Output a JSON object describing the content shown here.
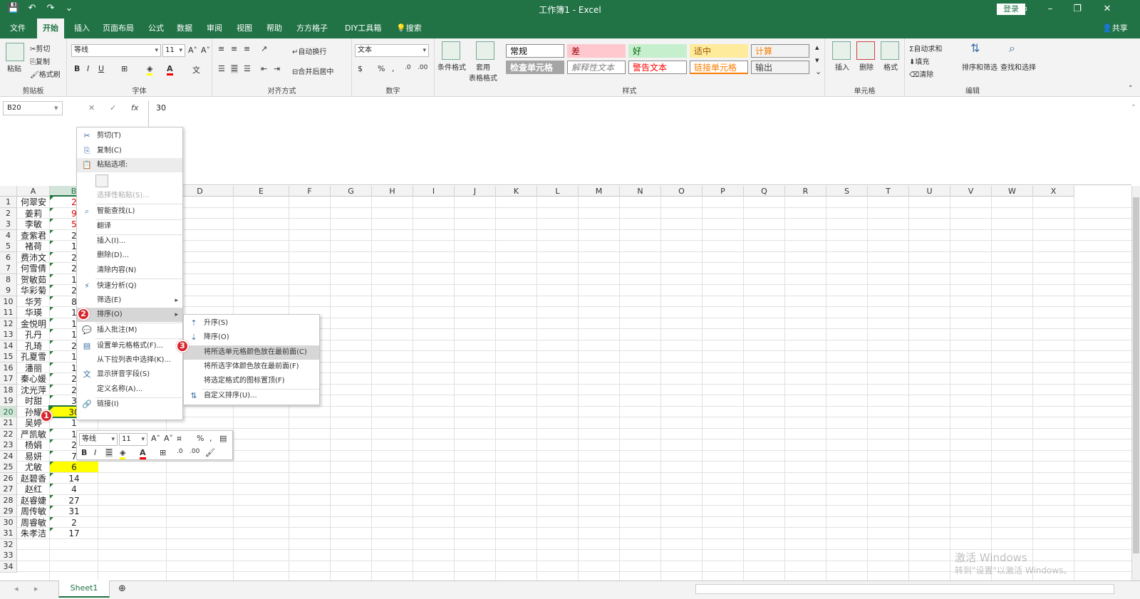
{
  "window": {
    "title": "工作簿1  -  Excel",
    "login": "登录"
  },
  "tabs": [
    "文件",
    "开始",
    "插入",
    "页面布局",
    "公式",
    "数据",
    "审阅",
    "视图",
    "帮助",
    "方方格子",
    "DIY工具箱"
  ],
  "search_label": "搜索",
  "share_label": "共享",
  "ribbon": {
    "clipboard": {
      "label": "剪贴板",
      "paste": "粘贴",
      "cut": "剪切",
      "copy": "复制",
      "format_painter": "格式刷"
    },
    "font": {
      "label": "字体",
      "name": "等线",
      "size": "11"
    },
    "align": {
      "label": "对齐方式",
      "wrap": "自动换行",
      "merge": "合并后居中"
    },
    "number": {
      "label": "数字",
      "format": "文本"
    },
    "styles_group": {
      "label": "样式",
      "cond": "条件格式",
      "table": "套用\n表格格式"
    },
    "styles": [
      {
        "text": "常规",
        "bg": "#ffffff",
        "fg": "#000000"
      },
      {
        "text": "差",
        "bg": "#ffc7ce",
        "fg": "#9c0006"
      },
      {
        "text": "好",
        "bg": "#c6efce",
        "fg": "#006100"
      },
      {
        "text": "适中",
        "bg": "#ffeb9c",
        "fg": "#9c5700"
      },
      {
        "text": "计算",
        "bg": "#f2f2f2",
        "fg": "#fa7d00"
      },
      {
        "text": "检查单元格",
        "bg": "#a5a5a5",
        "fg": "#ffffff"
      },
      {
        "text": "解释性文本",
        "bg": "#ffffff",
        "fg": "#7f7f7f"
      },
      {
        "text": "警告文本",
        "bg": "#ffffff",
        "fg": "#ff0000"
      },
      {
        "text": "链接单元格",
        "bg": "#ffffff",
        "fg": "#fa7d00"
      },
      {
        "text": "输出",
        "bg": "#f2f2f2",
        "fg": "#3f3f3f"
      }
    ],
    "cells": {
      "label": "单元格",
      "insert": "插入",
      "delete": "删除",
      "format": "格式"
    },
    "editing": {
      "label": "编辑",
      "autosum": "自动求和",
      "fill": "填充",
      "clear": "清除",
      "sort": "排序和筛选",
      "find": "查找和选择"
    }
  },
  "formula_bar": {
    "name_box": "B20",
    "value": "30",
    "fx": "fx"
  },
  "columns": [
    "A",
    "B",
    "C",
    "D",
    "E",
    "F",
    "G",
    "H",
    "I",
    "J",
    "K",
    "L",
    "M",
    "N",
    "O",
    "P",
    "Q",
    "R",
    "S",
    "T",
    "U",
    "V",
    "W",
    "X"
  ],
  "rows": [
    {
      "n": "1",
      "name": "何翠安",
      "val": "2"
    },
    {
      "n": "2",
      "name": "姜莉",
      "val": "9"
    },
    {
      "n": "3",
      "name": "李敏",
      "val": "5"
    },
    {
      "n": "4",
      "name": "查紫君",
      "val": "2"
    },
    {
      "n": "5",
      "name": "褚荷",
      "val": "1"
    },
    {
      "n": "6",
      "name": "费沛文",
      "val": "2"
    },
    {
      "n": "7",
      "name": "何雪倩",
      "val": "2"
    },
    {
      "n": "8",
      "name": "贺敏茹",
      "val": "1"
    },
    {
      "n": "9",
      "name": "华彩菊",
      "val": "2"
    },
    {
      "n": "10",
      "name": "华芳",
      "val": "8"
    },
    {
      "n": "11",
      "name": "华瑛",
      "val": "1"
    },
    {
      "n": "12",
      "name": "金悦明",
      "val": "1"
    },
    {
      "n": "13",
      "name": "孔丹",
      "val": "1"
    },
    {
      "n": "14",
      "name": "孔琦",
      "val": "2"
    },
    {
      "n": "15",
      "name": "孔夏雪",
      "val": "1"
    },
    {
      "n": "16",
      "name": "潘丽",
      "val": "1"
    },
    {
      "n": "17",
      "name": "秦心媛",
      "val": "2"
    },
    {
      "n": "18",
      "name": "沈光萍",
      "val": "2"
    },
    {
      "n": "19",
      "name": "时甜",
      "val": "3"
    },
    {
      "n": "20",
      "name": "孙耀",
      "val": "30"
    },
    {
      "n": "21",
      "name": "吴婷",
      "val": "1"
    },
    {
      "n": "22",
      "name": "严凯敏",
      "val": "1"
    },
    {
      "n": "23",
      "name": "杨娟",
      "val": "2"
    },
    {
      "n": "24",
      "name": "易妍",
      "val": "7"
    },
    {
      "n": "25",
      "name": "尤敏",
      "val": "6"
    },
    {
      "n": "26",
      "name": "赵碧香",
      "val": "14"
    },
    {
      "n": "27",
      "name": "赵红",
      "val": "4"
    },
    {
      "n": "28",
      "name": "赵睿婕",
      "val": "27"
    },
    {
      "n": "29",
      "name": "周传敏",
      "val": "31"
    },
    {
      "n": "30",
      "name": "周睿敏",
      "val": "2"
    },
    {
      "n": "31",
      "name": "朱孝洁",
      "val": "17"
    },
    {
      "n": "32",
      "name": "",
      "val": ""
    },
    {
      "n": "33",
      "name": "",
      "val": ""
    },
    {
      "n": "34",
      "name": "",
      "val": ""
    }
  ],
  "context_menu": {
    "cut": "剪切(T)",
    "copy": "复制(C)",
    "paste_options": "粘贴选项:",
    "paste_special": "选择性粘贴(S)...",
    "smart_lookup": "智能查找(L)",
    "translate": "翻译",
    "insert": "插入(I)...",
    "delete": "删除(D)...",
    "clear": "清除内容(N)",
    "quick_analysis": "快速分析(Q)",
    "filter": "筛选(E)",
    "sort": "排序(O)",
    "insert_comment": "插入批注(M)",
    "format_cells": "设置单元格格式(F)...",
    "pick_list": "从下拉列表中选择(K)...",
    "phonetic": "显示拼音字段(S)",
    "define_name": "定义名称(A)...",
    "link": "链接(I)"
  },
  "sort_submenu": {
    "asc": "升序(S)",
    "desc": "降序(O)",
    "cell_color": "将所选单元格颜色放在最前面(C)",
    "font_color": "将所选字体颜色放在最前面(F)",
    "icon": "将选定格式的图标置顶(F)",
    "custom": "自定义排序(U)..."
  },
  "mini_toolbar": {
    "font": "等线",
    "size": "11"
  },
  "badges": [
    "1",
    "2",
    "3"
  ],
  "sheet_tab": "Sheet1",
  "activate": {
    "line1": "激活 Windows",
    "line2": "转到\"设置\"以激活 Windows。"
  },
  "colors": {
    "excel_green": "#217346",
    "highlight_yellow": "#ffff00",
    "badge_red": "#d8262d"
  }
}
